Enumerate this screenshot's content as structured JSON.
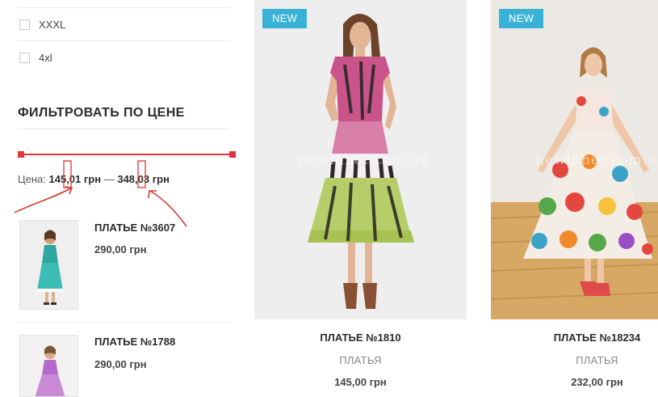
{
  "sidebar": {
    "sizes": [
      {
        "label": "XXXL"
      },
      {
        "label": "4xl"
      }
    ],
    "price_filter": {
      "title": "ФИЛЬТРОВАТЬ ПО ЦЕНЕ",
      "price_label": "Цена:",
      "min_price": "145,01 грн",
      "separator": "—",
      "max_price": "348,03 грн",
      "slider_min_fraction": 0.0,
      "slider_max_fraction": 1.0
    },
    "mini_products": [
      {
        "name": "ПЛАТЬЕ №3607",
        "price": "290,00 грн"
      },
      {
        "name": "ПЛАТЬЕ №1788",
        "price": "290,00 грн"
      }
    ]
  },
  "products": [
    {
      "badge": "NEW",
      "watermark": "newinner.com.ua",
      "name": "ПЛАТЬЕ №1810",
      "category": "ПЛАТЬЯ",
      "price": "145,00 грн"
    },
    {
      "badge": "NEW",
      "watermark": "newinner.com.ua",
      "name": "ПЛАТЬЕ №18234",
      "category": "ПЛАТЬЯ",
      "price": "232,00 грн"
    }
  ],
  "colors": {
    "accent": "#e0353a",
    "badge": "#3ab2d6",
    "annotation": "#d63a2f"
  }
}
